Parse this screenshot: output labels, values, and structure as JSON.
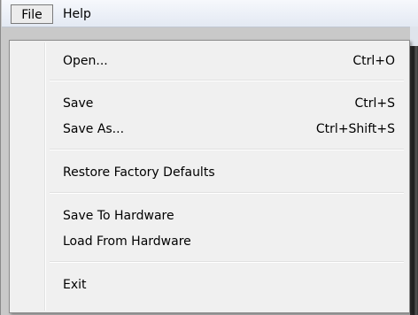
{
  "menubar": {
    "file_label": "File",
    "help_label": "Help"
  },
  "file_menu": {
    "open": {
      "label": "Open...",
      "shortcut": "Ctrl+O"
    },
    "save": {
      "label": "Save",
      "shortcut": "Ctrl+S"
    },
    "save_as": {
      "label": "Save As...",
      "shortcut": "Ctrl+Shift+S"
    },
    "restore": {
      "label": "Restore Factory Defaults"
    },
    "save_to_hw": {
      "label": "Save To Hardware"
    },
    "load_from_hw": {
      "label": "Load From Hardware"
    },
    "exit": {
      "label": "Exit"
    }
  }
}
